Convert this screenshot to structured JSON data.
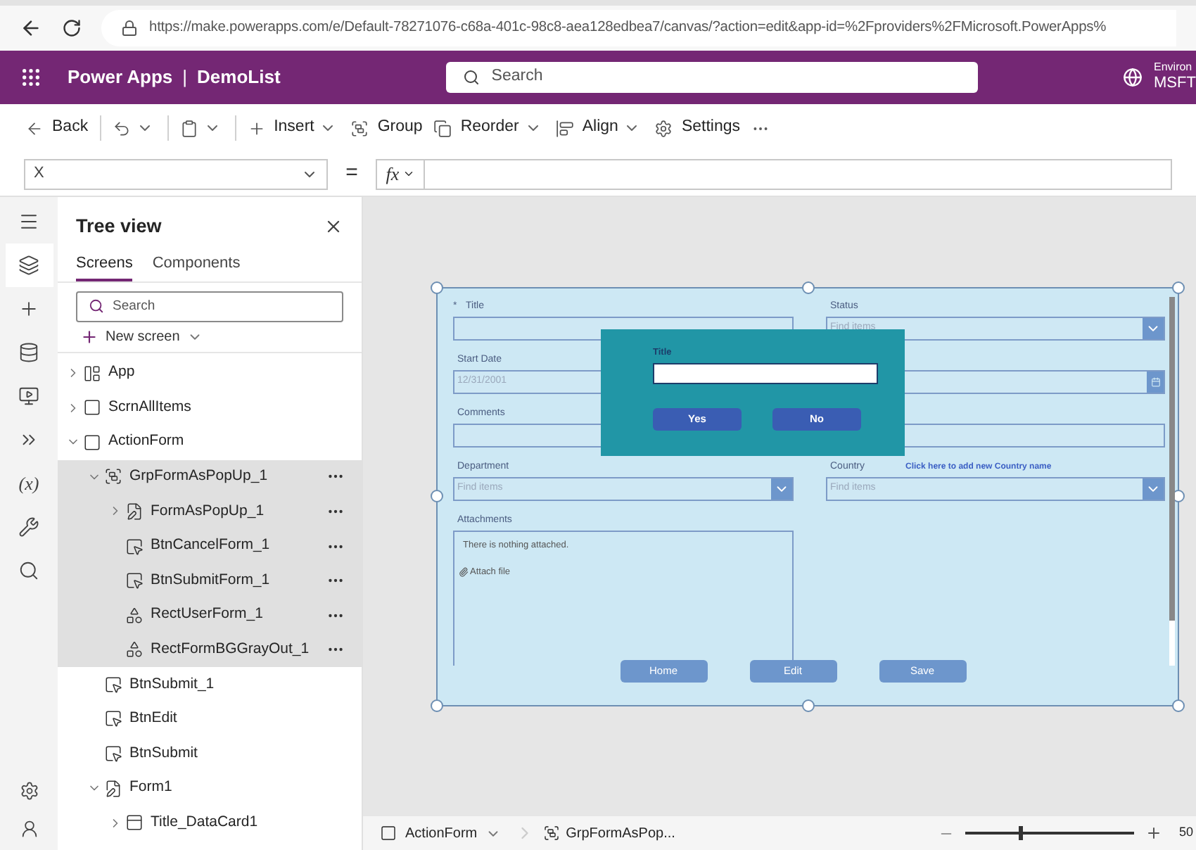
{
  "browser": {
    "url": "https://make.powerapps.com/e/Default-78271076-c68a-401c-98c8-aea128edbea7/canvas/?action=edit&app-id=%2Fproviders%2FMicrosoft.PowerApps%"
  },
  "header": {
    "product": "Power Apps",
    "separator": "|",
    "app_name": "DemoList",
    "search_placeholder": "Search",
    "environment_label": "Environ",
    "environment_name": "MSFT"
  },
  "toolbar": [
    {
      "kind": "back",
      "label": "Back",
      "dropdown": false
    },
    {
      "kind": "undo",
      "dropdown": true
    },
    {
      "kind": "paste",
      "dropdown": true
    },
    {
      "kind": "insert",
      "label": "Insert",
      "dropdown": true
    },
    {
      "kind": "group",
      "label": "Group",
      "dropdown": false
    },
    {
      "kind": "reorder",
      "label": "Reorder",
      "dropdown": true
    },
    {
      "kind": "align",
      "label": "Align",
      "dropdown": true
    },
    {
      "kind": "settings",
      "label": "Settings",
      "dropdown": false
    },
    {
      "kind": "more",
      "dropdown": false
    }
  ],
  "formula_bar": {
    "property": "X",
    "equals": "=",
    "fx": "fx"
  },
  "rail": [
    {
      "kind": "menu",
      "selected": false
    },
    {
      "kind": "tree",
      "selected": true
    },
    {
      "kind": "insert",
      "selected": false
    },
    {
      "kind": "data",
      "selected": false
    },
    {
      "kind": "media",
      "selected": false
    },
    {
      "kind": "automate",
      "selected": false
    },
    {
      "kind": "variables",
      "label": "(x)",
      "selected": false
    },
    {
      "kind": "tools",
      "selected": false
    },
    {
      "kind": "search",
      "selected": false
    }
  ],
  "rail_bottom": [
    {
      "kind": "settings",
      "selected": false
    },
    {
      "kind": "agent",
      "selected": false
    }
  ],
  "tree_view": {
    "title": "Tree view",
    "tabs": [
      {
        "label": "Screens",
        "selected": true
      },
      {
        "label": "Components",
        "selected": false
      }
    ],
    "search_placeholder": "Search",
    "new_screen": "New screen",
    "items": [
      {
        "label": "App",
        "kind": "app",
        "expanded": false,
        "selected": false
      },
      {
        "label": "ScrnAllItems",
        "kind": "screen",
        "expanded": false,
        "selected": false
      },
      {
        "label": "ActionForm",
        "kind": "screen",
        "expanded": true,
        "selected": false,
        "children": [
          {
            "label": "GrpFormAsPopUp_1",
            "kind": "group",
            "expanded": true,
            "selected": true,
            "children": [
              {
                "label": "FormAsPopUp_1",
                "kind": "form",
                "expanded": false,
                "selected": true
              },
              {
                "label": "BtnCancelForm_1",
                "kind": "button",
                "selected": true
              },
              {
                "label": "BtnSubmitForm_1",
                "kind": "button",
                "selected": true
              },
              {
                "label": "RectUserForm_1",
                "kind": "rect",
                "selected": true
              },
              {
                "label": "RectFormBGGrayOut_1",
                "kind": "rect",
                "selected": true
              }
            ]
          },
          {
            "label": "BtnSubmit_1",
            "kind": "button",
            "selected": false
          },
          {
            "label": "BtnEdit",
            "kind": "button",
            "selected": false
          },
          {
            "label": "BtnSubmit",
            "kind": "button",
            "selected": false
          },
          {
            "label": "Form1",
            "kind": "form",
            "expanded": true,
            "selected": false,
            "children": [
              {
                "label": "Title_DataCard1",
                "kind": "card",
                "expanded": false,
                "selected": false
              }
            ]
          }
        ]
      }
    ]
  },
  "canvas": {
    "rows": [
      [
        {
          "kind": "text",
          "label": "Title",
          "required_mark": "*"
        },
        {
          "kind": "dropdown",
          "label": "Status",
          "placeholder": "Find items"
        }
      ],
      [
        {
          "kind": "date",
          "label": "Start Date",
          "value": "12/31/2001"
        },
        {
          "kind": "date"
        }
      ],
      [
        {
          "kind": "text",
          "label": "Comments"
        },
        {
          "kind": "text"
        }
      ],
      [
        {
          "kind": "dropdown",
          "label": "Department",
          "placeholder": "Find items"
        },
        {
          "kind": "dropdown",
          "label": "Country",
          "link": "Click here to add new Country name",
          "placeholder": "Find items"
        }
      ]
    ],
    "attachments": {
      "label": "Attachments",
      "empty_text": "There is nothing attached.",
      "attach": "Attach file"
    },
    "buttons": [
      "Home",
      "Edit",
      "Save"
    ],
    "popup": {
      "label": "Title",
      "buttons": [
        "Yes",
        "No"
      ]
    }
  },
  "status_bar": {
    "screen": "ActionForm",
    "selection": "GrpFormAsPop...",
    "zoom": {
      "level": 0.32,
      "reading": "50"
    }
  }
}
